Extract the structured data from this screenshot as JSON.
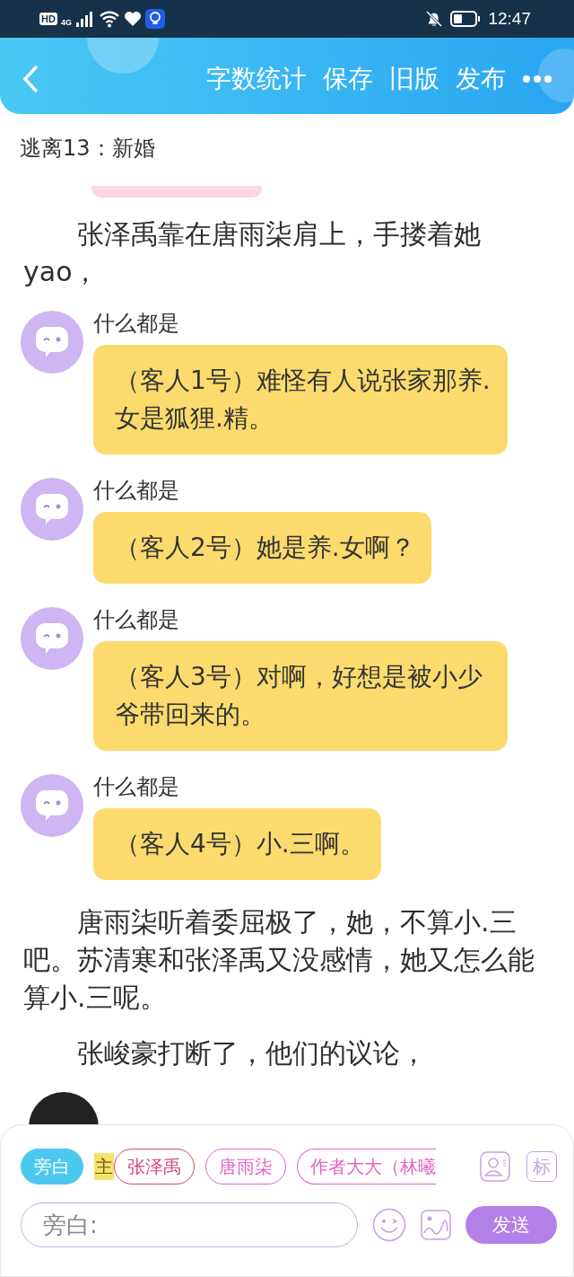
{
  "status_bar": {
    "hd": "HD",
    "network": "4G",
    "time": "12:47"
  },
  "header": {
    "actions": [
      "字数统计",
      "保存",
      "旧版",
      "发布"
    ]
  },
  "chapter_title": "逃离13：新婚",
  "content": [
    {
      "kind": "paragraph",
      "text": "张泽禹靠在唐雨柒肩上，手搂着她yao，"
    },
    {
      "kind": "dialogue",
      "name": "什么都是",
      "text": "（客人1号）难怪有人说张家那养.女是狐狸.精。"
    },
    {
      "kind": "dialogue",
      "name": "什么都是",
      "text": "（客人2号）她是养.女啊？"
    },
    {
      "kind": "dialogue",
      "name": "什么都是",
      "text": "（客人3号）对啊，好想是被小少爷带回来的。"
    },
    {
      "kind": "dialogue",
      "name": "什么都是",
      "text": "（客人4号）小.三啊。"
    },
    {
      "kind": "paragraph",
      "text": "唐雨柒听着委屈极了，她，不算小.三吧。苏清寒和张泽禹又没感情，她又怎么能算小.三呢。"
    },
    {
      "kind": "paragraph",
      "text": "张峻豪打断了，他们的议论，"
    }
  ],
  "composer": {
    "roles": [
      {
        "label": "旁白",
        "selected": true,
        "color": "#4cc8ef"
      },
      {
        "label": "张泽禹",
        "selected": false,
        "color": "#d4467c",
        "badge": "主"
      },
      {
        "label": "唐雨柒",
        "selected": false,
        "color": "#e066c8"
      },
      {
        "label": "作者大大（林曦",
        "selected": false,
        "color": "#e066c8"
      }
    ],
    "mark_key": "标",
    "input": {
      "placeholder": "旁白:"
    },
    "send": "发送"
  }
}
